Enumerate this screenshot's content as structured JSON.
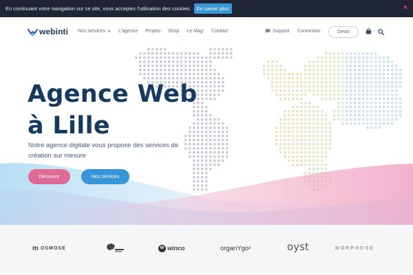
{
  "cookie": {
    "message": "En continuant votre navigation sur ce site, vous acceptez l'utilisation des cookies.",
    "button_label": "En savoir plus",
    "close_glyph": "×"
  },
  "header": {
    "logo_text": "webinti",
    "nav": [
      {
        "label": "Nos services",
        "caret": "▼"
      },
      {
        "label": "L'agence"
      },
      {
        "label": "Projets"
      },
      {
        "label": "Shop"
      },
      {
        "label": "Le Mag'"
      },
      {
        "label": "Contact"
      }
    ],
    "support_label": "Support",
    "connexion_label": "Connexion",
    "devis_label": "Devis",
    "icons": {
      "cart": "shopping-bag-icon",
      "search": "search-icon",
      "support": "chat-icon"
    }
  },
  "hero": {
    "title_line1": "Agence Web",
    "title_line2": "à Lille",
    "subtitle": "Notre agence digitale vous propose des services de création sur mesure",
    "btn_primary": "Découvrir",
    "btn_secondary": "Nos services"
  },
  "clients": {
    "osmose": "OSMOSE",
    "osmose_mark": "m",
    "winco": "winco",
    "winco_mark": "W",
    "organygo": "organYgo",
    "organygo_sup": "x",
    "oyst": "oyst",
    "morph": "MORPHOSE"
  },
  "colors": {
    "cookie_bg": "#1f2535",
    "cookie_button": "#3b97d6",
    "title": "#163a5f",
    "pink_button": "#df6b94",
    "blue_button": "#3a95d8",
    "clients_bg": "#f5f6f8"
  }
}
